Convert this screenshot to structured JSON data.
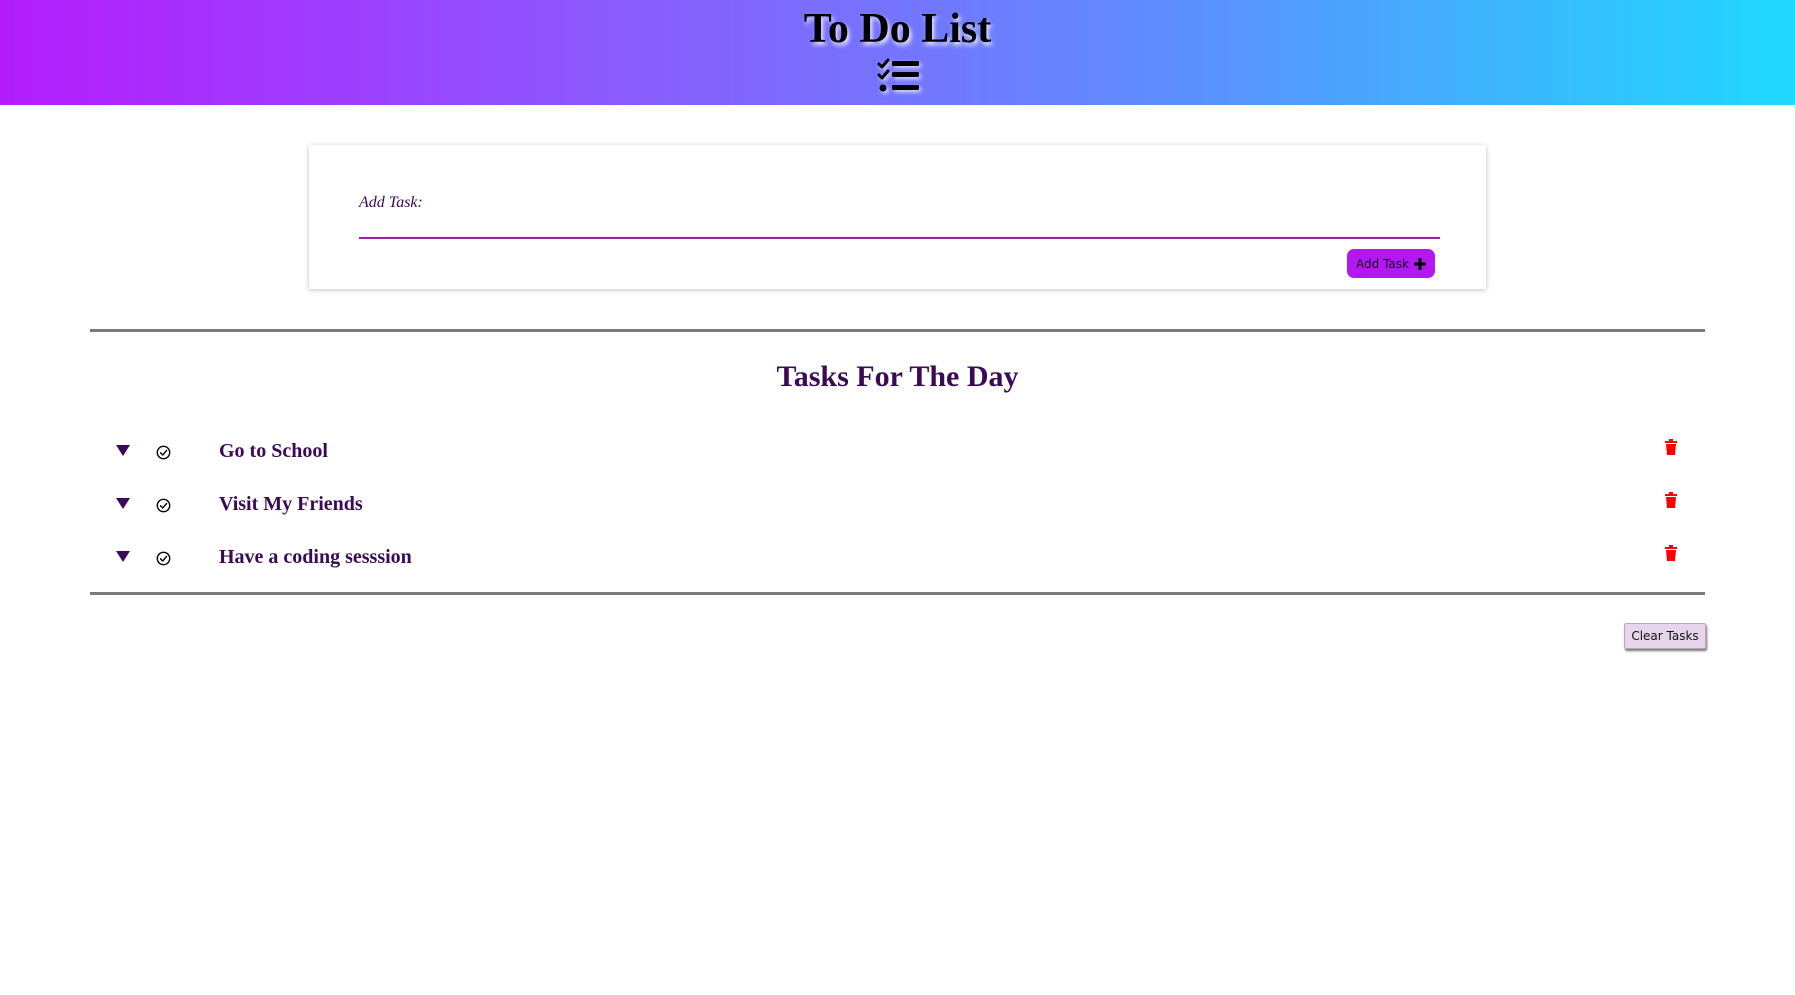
{
  "header": {
    "title": "To Do List",
    "icon": "tasks-list-icon",
    "gradient": [
      "#b41cfd",
      "#1fd9fe"
    ]
  },
  "add_form": {
    "label": "Add Task:",
    "input_value": "",
    "button_label": "Add Task",
    "button_icon": "plus-icon",
    "accent": "#b418f0"
  },
  "tasks_section": {
    "title": "Tasks For The Day",
    "items": [
      {
        "text": "Go to School"
      },
      {
        "text": "Visit My Friends"
      },
      {
        "text": "Have a coding sesssion"
      }
    ],
    "item_icons": {
      "toggle": "caret-down-icon",
      "complete": "check-circle-icon",
      "delete": "trash-icon"
    },
    "text_color": "#3a0a55",
    "delete_color": "#ff0000"
  },
  "footer": {
    "clear_label": "Clear Tasks"
  }
}
